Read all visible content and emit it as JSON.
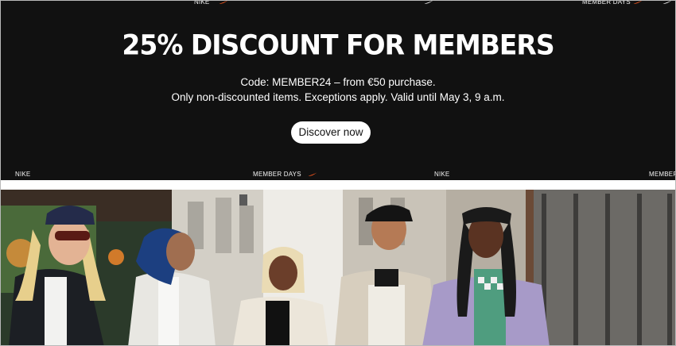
{
  "colors": {
    "background": "#111111",
    "text": "#ffffff",
    "button_bg": "#ffffff",
    "button_text": "#111111",
    "swoosh": "#ff5a1f"
  },
  "ticker": {
    "brand": "NIKE",
    "campaign": "MEMBER DAYS",
    "top_brand_label": "NIKE",
    "top_campaign_label": "MEMBER DAYS"
  },
  "promo": {
    "headline": "25% DISCOUNT FOR MEMBERS",
    "code_line": "Code: MEMBER24 – from €50 purchase.",
    "terms_line": "Only non-discounted items. Exceptions apply. Valid until May 3, 9 a.m.",
    "cta_label": "Discover now"
  },
  "hero": {
    "icons": [
      "swoosh-icon"
    ]
  }
}
